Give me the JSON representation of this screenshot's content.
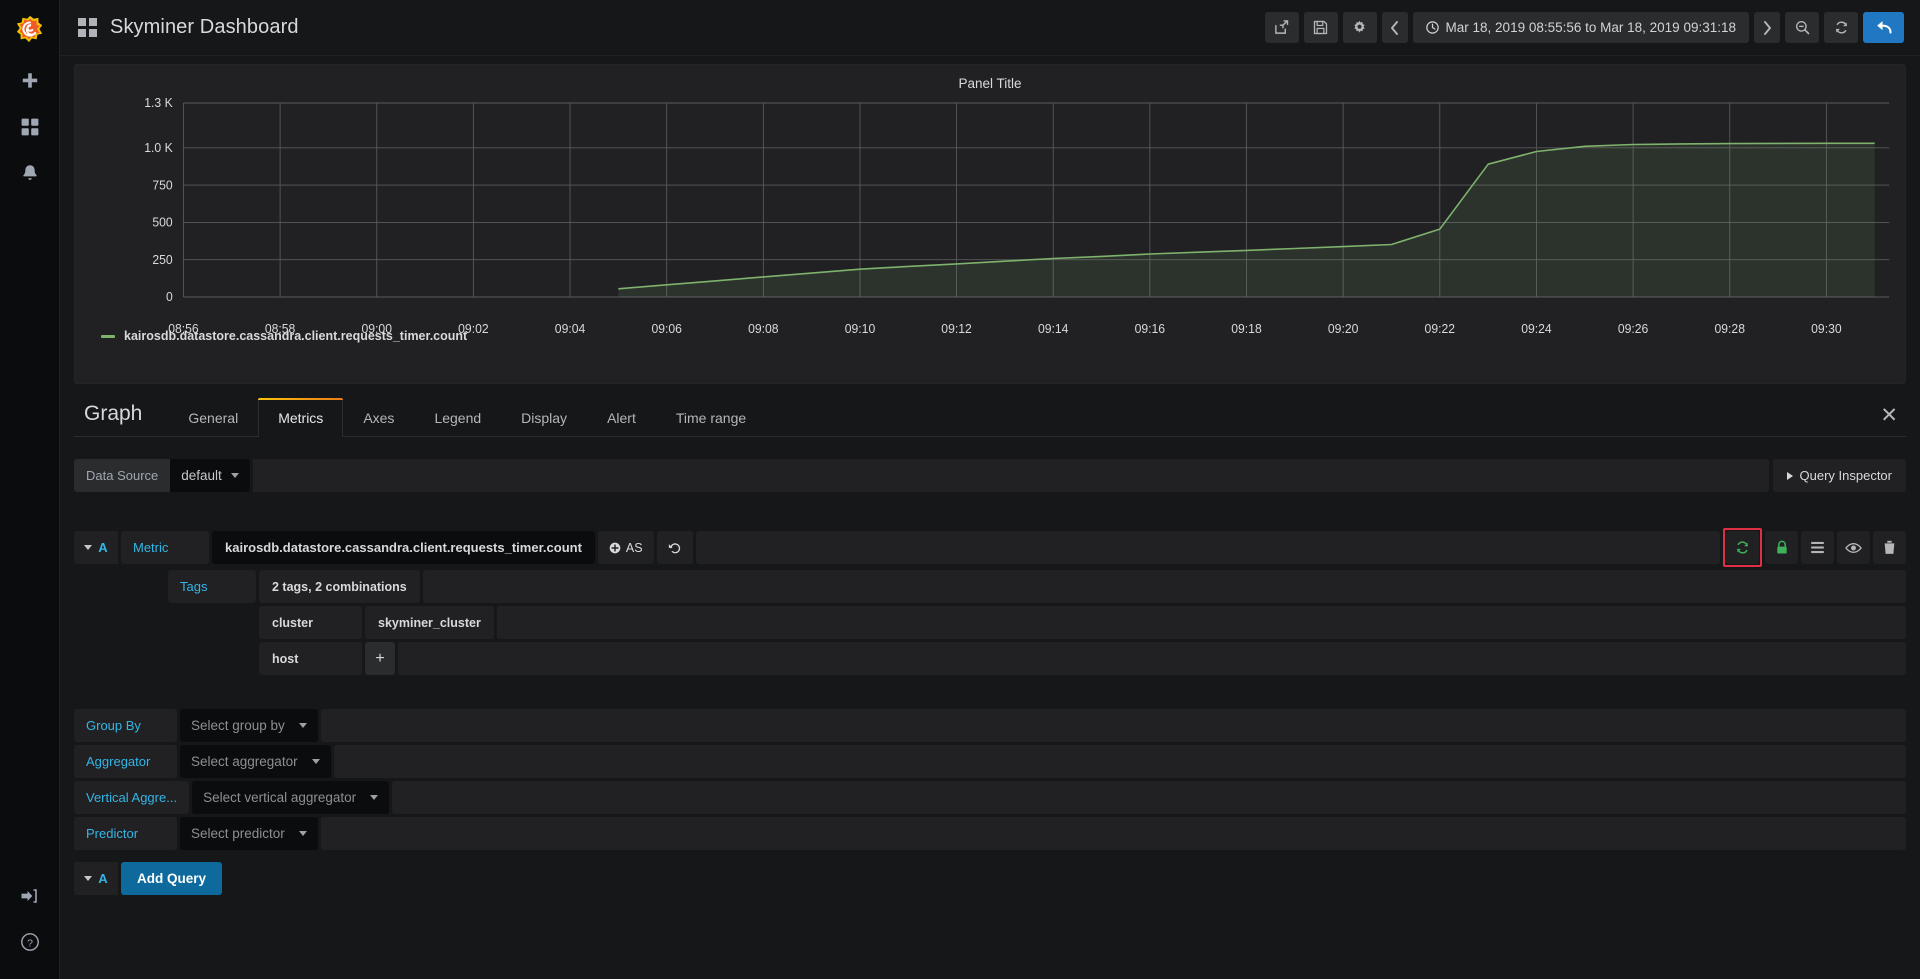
{
  "sidebar": {
    "logo_icon": "grafana-logo-icon",
    "items": [
      {
        "icon": "plus-icon",
        "name": "create"
      },
      {
        "icon": "dashboards-grid-icon",
        "name": "dashboards"
      },
      {
        "icon": "bell-icon",
        "name": "alerting"
      }
    ],
    "bottom_items": [
      {
        "icon": "sign-in-icon",
        "name": "sign-in"
      },
      {
        "icon": "help-circle-icon",
        "name": "help"
      }
    ]
  },
  "topnav": {
    "dashboard_icon": "dashboard-grid-icon",
    "title": "Skyminer Dashboard",
    "share_icon": "share-icon",
    "save_icon": "save-icon",
    "settings_icon": "gear-icon",
    "prev_icon": "chevron-left-icon",
    "next_icon": "chevron-right-icon",
    "clock_icon": "clock-icon",
    "time_range": "Mar 18, 2019 08:55:56 to Mar 18, 2019 09:31:18",
    "zoom_out_icon": "zoom-out-icon",
    "refresh_icon": "refresh-icon",
    "back_icon": "back-arrow-icon"
  },
  "panel": {
    "title": "Panel Title",
    "legend_label": "kairosdb.datastore.cassandra.client.requests_timer.count",
    "series_color": "#7eb26d"
  },
  "chart_data": {
    "type": "area",
    "title": "Panel Title",
    "xlabel": "",
    "ylabel": "",
    "grid": true,
    "legend_position": "bottom-left",
    "series": [
      {
        "name": "kairosdb.datastore.cassandra.client.requests_timer.count",
        "color": "#7eb26d",
        "x": [
          "09:05",
          "09:06",
          "09:07",
          "09:08",
          "09:09",
          "09:10",
          "09:11",
          "09:12",
          "09:13",
          "09:14",
          "09:15",
          "09:16",
          "09:17",
          "09:18",
          "09:19",
          "09:20",
          "09:21",
          "09:22",
          "09:23",
          "09:24",
          "09:25",
          "09:26",
          "09:27",
          "09:28",
          "09:29",
          "09:30",
          "09:31"
        ],
        "values": [
          55,
          82,
          108,
          135,
          160,
          186,
          205,
          222,
          240,
          258,
          272,
          288,
          300,
          312,
          325,
          338,
          352,
          455,
          890,
          975,
          1010,
          1022,
          1026,
          1028,
          1029,
          1030,
          1030
        ]
      }
    ],
    "ytick_labels": [
      "0",
      "250",
      "500",
      "750",
      "1.0 K",
      "1.3 K"
    ],
    "ytick_values": [
      0,
      250,
      500,
      750,
      1000,
      1300
    ],
    "ylim": [
      0,
      1300
    ],
    "xtick_labels": [
      "08:56",
      "08:58",
      "09:00",
      "09:02",
      "09:04",
      "09:06",
      "09:08",
      "09:10",
      "09:12",
      "09:14",
      "09:16",
      "09:18",
      "09:20",
      "09:22",
      "09:24",
      "09:26",
      "09:28",
      "09:30"
    ]
  },
  "editor": {
    "panel_type": "Graph",
    "tabs": [
      {
        "label": "General",
        "active": false
      },
      {
        "label": "Metrics",
        "active": true
      },
      {
        "label": "Axes",
        "active": false
      },
      {
        "label": "Legend",
        "active": false
      },
      {
        "label": "Display",
        "active": false
      },
      {
        "label": "Alert",
        "active": false
      },
      {
        "label": "Time range",
        "active": false
      }
    ],
    "close_icon": "close-icon",
    "datasource": {
      "label": "Data Source",
      "value": "default"
    },
    "query_inspector": "Query Inspector",
    "query": {
      "letter": "A",
      "metric_label": "Metric",
      "metric_value": "kairosdb.datastore.cassandra.client.requests_timer.count",
      "as_label": "AS",
      "as_icon": "plus-circle-icon",
      "undo_icon": "undo-icon",
      "actions": [
        {
          "icon": "sync-icon",
          "name": "toggle-sync",
          "highlighted": true,
          "color": "#3eb15b"
        },
        {
          "icon": "lock-icon",
          "name": "lock-query",
          "highlighted": false,
          "color": "#3eb15b"
        },
        {
          "icon": "hamburger-icon",
          "name": "query-options",
          "highlighted": false,
          "color": "#b5b6b8"
        },
        {
          "icon": "eye-icon",
          "name": "toggle-visibility",
          "highlighted": false,
          "color": "#b5b6b8"
        },
        {
          "icon": "trash-icon",
          "name": "delete-query",
          "highlighted": false,
          "color": "#b5b6b8"
        }
      ],
      "tags_label": "Tags",
      "tags_summary": "2 tags, 2 combinations",
      "tag_rows": [
        {
          "key": "cluster",
          "value": "skyminer_cluster",
          "add": false
        },
        {
          "key": "host",
          "value": "",
          "add": true
        }
      ],
      "selects": [
        {
          "label": "Group By",
          "placeholder": "Select group by"
        },
        {
          "label": "Aggregator",
          "placeholder": "Select aggregator"
        },
        {
          "label": "Vertical Aggre...",
          "placeholder": "Select vertical aggregator"
        },
        {
          "label": "Predictor",
          "placeholder": "Select predictor"
        }
      ],
      "add_query_letter": "A",
      "add_query_label": "Add Query"
    }
  }
}
